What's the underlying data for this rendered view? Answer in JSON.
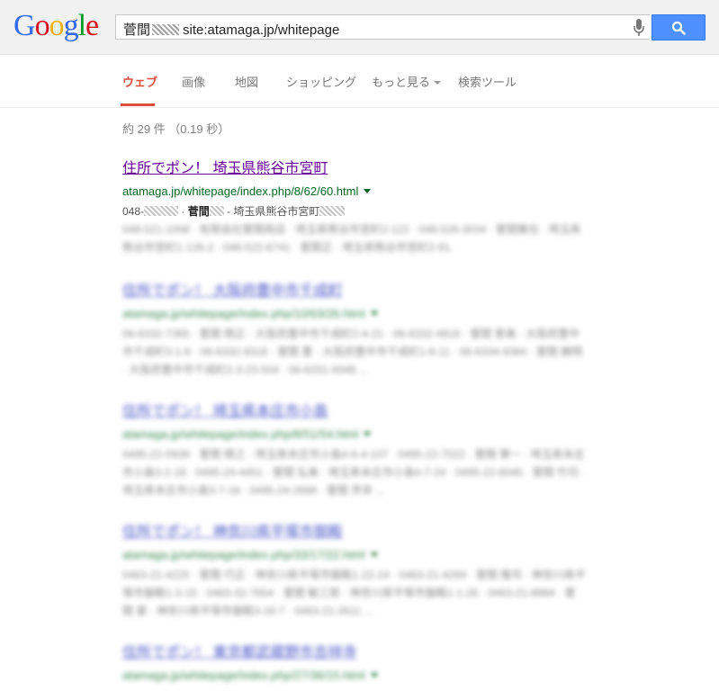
{
  "header": {
    "logo": "Google",
    "query_prefix": "菅間",
    "query_suffix": "site:atamaga.jp/whitepage",
    "search_button_icon": "magnifier-icon",
    "mic_icon": "microphone-icon",
    "accent_color": "#4d90fe"
  },
  "nav": {
    "tabs": [
      "ウェブ",
      "画像",
      "地図",
      "ショッピング",
      "もっと見る",
      "検索ツール"
    ],
    "active_index": 0,
    "active_color": "#dd4b39"
  },
  "stats": "約 29 件 （0.19 秒）",
  "results": [
    {
      "title": "住所でポン！ 埼玉県熊谷市宮町",
      "url": "atamaga.jp/whitepage/index.php/8/62/60.html",
      "snippet_prefix": "048-",
      "snippet_name": "菅間",
      "snippet_rest": "- 埼玉県熊谷市宮町",
      "snippet_blurred": "048-521-1008 · 有限会社菅間商店 · 埼玉県熊谷市宮町2-122 · 048-526-3034 · 菅間雅也 · 埼玉県熊谷市宮町1-126-2 · 048-522-6741 · 菅間正 · 埼玉県熊谷市宮町2-91."
    },
    {
      "title": "住所でポン！ 大阪府豊中市千成町",
      "url": "atamaga.jp/whitepage/index.php/10/63/26.html",
      "snippet": "06-6332-7365 · 菅間 晴正 · 大阪府豊中市千成町2-4-21 · 06-6332-4816 · 菅間 恵美 · 大阪府豊中市千成町3-1-6 · 06-6332-9316 · 菅間 豊 · 大阪府豊中市千成町1-6-11 · 06-6334-9384 · 菅間 勝明 · 大阪府豊中市千成町2-3-23-504 · 06-6331-9348 ..."
    },
    {
      "title": "住所でポン！ 埼玉県本庄市小島",
      "url": "atamaga.jp/whitepage/index.php/8/51/54.html",
      "snippet": "0495-22-0939 · 菅間 晴之 · 埼玉県本庄市小島4-6-4-107 · 0495-22-7022 · 菅間 尊一 · 埼玉県本庄市小島3-2-18 · 0495-24-4451 · 菅間 弘美 · 埼玉県本庄市小島4-7-24 · 0495-22-6045 · 菅間 竹司 · 埼玉県本庄市小島3-7-18 · 0495-24-2668 · 菅間 芳幸 ..."
    },
    {
      "title": "住所でポン！ 神奈川県平塚市御殿",
      "url": "atamaga.jp/whitepage/index.php/33/17/22.html",
      "snippet": "0463-21-4225 · 菅間 巧正 · 神奈川県平塚市御殿1-22-24 · 0463-21-4269 · 菅間 隆司 · 神奈川県平塚市御殿1-3-15 · 0463-32-7654 · 菅間 敏三郎 · 神奈川県平塚市御殿1-1-26 · 0463-21-8984 · 菅間 豪 · 神奈川県平塚市御殿3-16-7 · 0463-21-2611 ..."
    },
    {
      "title": "住所でポン！ 東京都武蔵野市吉祥寺",
      "url": "atamaga.jp/whitepage/index.php/27/36/15.html",
      "snippet": ""
    }
  ]
}
